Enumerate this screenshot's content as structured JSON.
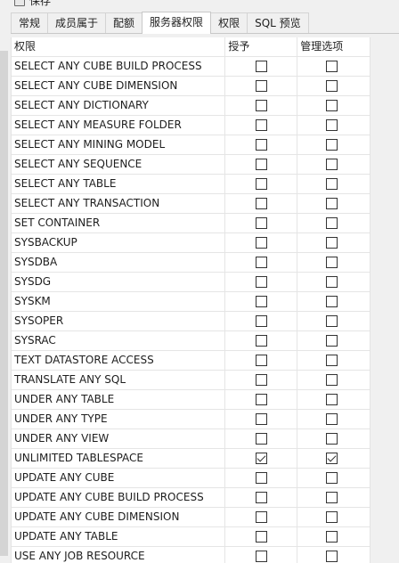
{
  "toolbar": {
    "save_label": "保存"
  },
  "tabs": [
    {
      "label": "常规",
      "active": false
    },
    {
      "label": "成员属于",
      "active": false
    },
    {
      "label": "配额",
      "active": false
    },
    {
      "label": "服务器权限",
      "active": true
    },
    {
      "label": "权限",
      "active": false
    },
    {
      "label": "SQL 预览",
      "active": false
    }
  ],
  "grid": {
    "headers": {
      "privilege": "权限",
      "grant": "授予",
      "admin": "管理选项"
    },
    "rows": [
      {
        "privilege": "SELECT ANY CUBE BUILD PROCESS",
        "grant": false,
        "admin": false
      },
      {
        "privilege": "SELECT ANY CUBE DIMENSION",
        "grant": false,
        "admin": false
      },
      {
        "privilege": "SELECT ANY DICTIONARY",
        "grant": false,
        "admin": false
      },
      {
        "privilege": "SELECT ANY MEASURE FOLDER",
        "grant": false,
        "admin": false
      },
      {
        "privilege": "SELECT ANY MINING MODEL",
        "grant": false,
        "admin": false
      },
      {
        "privilege": "SELECT ANY SEQUENCE",
        "grant": false,
        "admin": false
      },
      {
        "privilege": "SELECT ANY TABLE",
        "grant": false,
        "admin": false
      },
      {
        "privilege": "SELECT ANY TRANSACTION",
        "grant": false,
        "admin": false
      },
      {
        "privilege": "SET CONTAINER",
        "grant": false,
        "admin": false
      },
      {
        "privilege": "SYSBACKUP",
        "grant": false,
        "admin": false
      },
      {
        "privilege": "SYSDBA",
        "grant": false,
        "admin": false
      },
      {
        "privilege": "SYSDG",
        "grant": false,
        "admin": false
      },
      {
        "privilege": "SYSKM",
        "grant": false,
        "admin": false
      },
      {
        "privilege": "SYSOPER",
        "grant": false,
        "admin": false
      },
      {
        "privilege": "SYSRAC",
        "grant": false,
        "admin": false
      },
      {
        "privilege": "TEXT DATASTORE ACCESS",
        "grant": false,
        "admin": false
      },
      {
        "privilege": "TRANSLATE ANY SQL",
        "grant": false,
        "admin": false
      },
      {
        "privilege": "UNDER ANY TABLE",
        "grant": false,
        "admin": false
      },
      {
        "privilege": "UNDER ANY TYPE",
        "grant": false,
        "admin": false
      },
      {
        "privilege": "UNDER ANY VIEW",
        "grant": false,
        "admin": false
      },
      {
        "privilege": "UNLIMITED TABLESPACE",
        "grant": true,
        "admin": true
      },
      {
        "privilege": "UPDATE ANY CUBE",
        "grant": false,
        "admin": false
      },
      {
        "privilege": "UPDATE ANY CUBE BUILD PROCESS",
        "grant": false,
        "admin": false
      },
      {
        "privilege": "UPDATE ANY CUBE DIMENSION",
        "grant": false,
        "admin": false
      },
      {
        "privilege": "UPDATE ANY TABLE",
        "grant": false,
        "admin": false
      },
      {
        "privilege": "USE ANY JOB RESOURCE",
        "grant": false,
        "admin": false
      }
    ]
  }
}
